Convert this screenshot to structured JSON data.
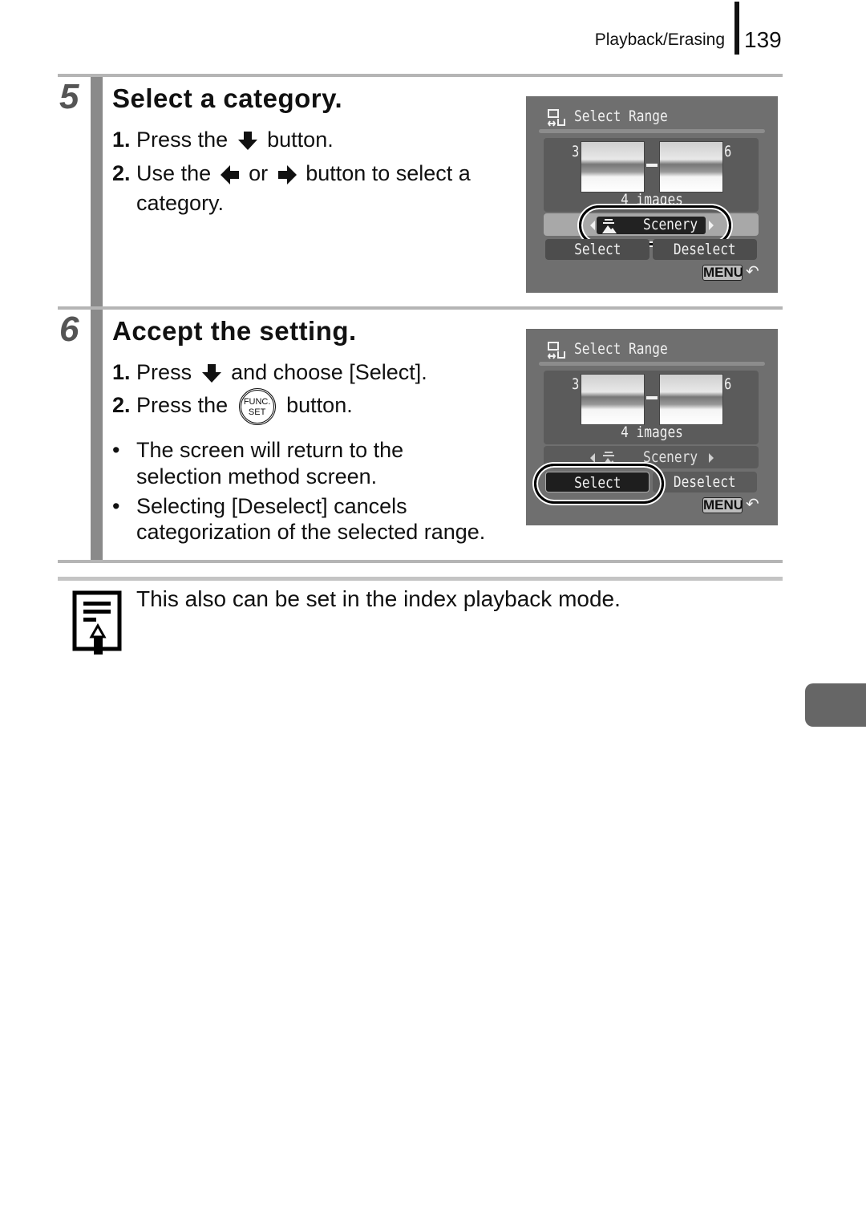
{
  "header": {
    "section": "Playback/Erasing",
    "page_number": "139"
  },
  "steps": [
    {
      "number": "5",
      "title": "Select a category.",
      "items": [
        {
          "num": "1.",
          "before": "Press the",
          "icon": "down-arrow-icon",
          "after": "button."
        },
        {
          "num": "2.",
          "before": "Use the",
          "icon1": "left-arrow-icon",
          "middle": "or",
          "icon2": "right-arrow-icon",
          "after": "button to select a",
          "continuation": "category."
        }
      ],
      "screen": {
        "title": "Select Range",
        "start_index": "3",
        "end_index": "6",
        "count": "4 images",
        "category": "Scenery",
        "select_label": "Select",
        "deselect_label": "Deselect",
        "menu_label": "MENU",
        "highlighted": "category"
      }
    },
    {
      "number": "6",
      "title": "Accept the setting.",
      "items": [
        {
          "num": "1.",
          "before": "Press",
          "icon": "down-arrow-icon",
          "after": "and choose [Select]."
        },
        {
          "num": "2.",
          "before": "Press the",
          "icon": "func-set-button-icon",
          "icon_text_top": "FUNC.",
          "icon_text_bottom": "SET",
          "after": "button."
        }
      ],
      "bullets": [
        [
          "The screen will return to the",
          "selection method screen."
        ],
        [
          "Selecting [Deselect] cancels",
          "categorization of the selected range."
        ]
      ],
      "screen": {
        "title": "Select Range",
        "start_index": "3",
        "end_index": "6",
        "count": "4 images",
        "category": "Scenery",
        "select_label": "Select",
        "deselect_label": "Deselect",
        "menu_label": "MENU",
        "highlighted": "select"
      }
    }
  ],
  "note": {
    "icon": "memo-pencil-icon",
    "text": "This also can be set in the index playback mode."
  },
  "colors": {
    "step_bar": "#8a8a8a",
    "rule": "#b5b5b5",
    "screen_bg": "#6f6f6f",
    "chapter_tab": "#666666"
  }
}
